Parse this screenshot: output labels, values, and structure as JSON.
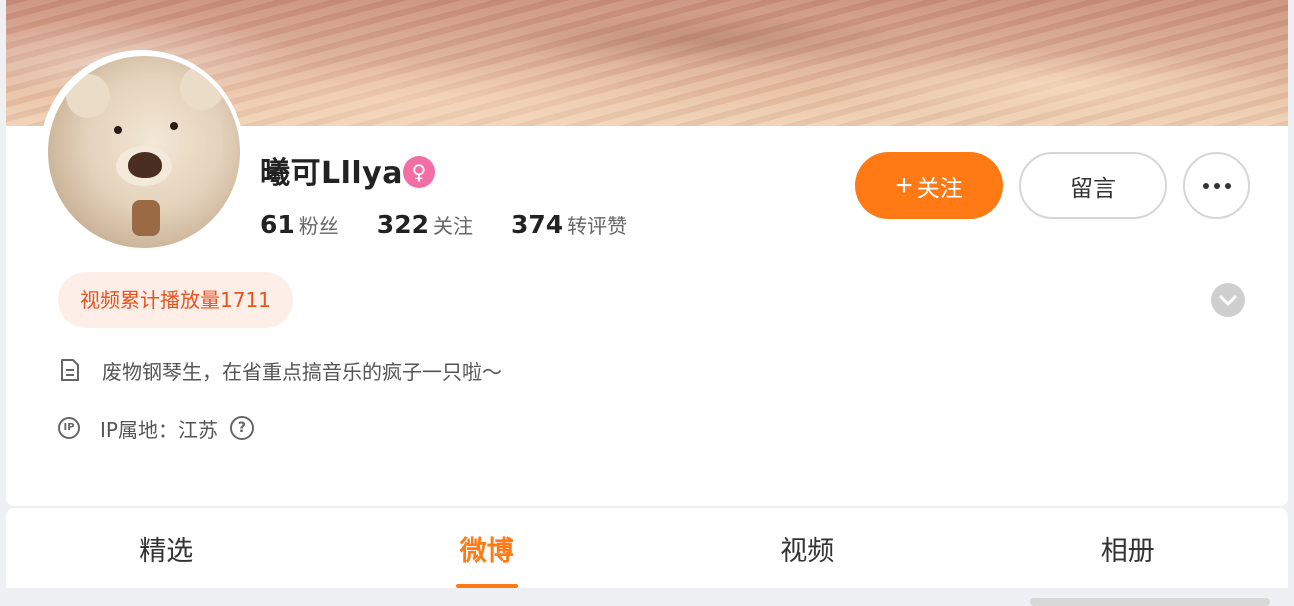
{
  "profile": {
    "name": "曦可Lllya",
    "gender_symbol": "♀",
    "stats": [
      {
        "value": "61",
        "label": "粉丝"
      },
      {
        "value": "322",
        "label": "关注"
      },
      {
        "value": "374",
        "label": "转评赞"
      }
    ],
    "tag": "视频累计播放量1711",
    "bio": "废物钢琴生，在省重点搞音乐的疯子一只啦～",
    "ip_label": "IP属地：江苏",
    "ip_icon_text": "IP",
    "help_icon_text": "?"
  },
  "actions": {
    "follow_plus": "+",
    "follow_label": "关注",
    "message_label": "留言"
  },
  "tabs": [
    {
      "label": "精选"
    },
    {
      "label": "微博"
    },
    {
      "label": "视频"
    },
    {
      "label": "相册"
    }
  ],
  "active_tab": "微博",
  "colors": {
    "accent": "#ff7a14",
    "tag_text": "#e8531e",
    "tag_bg": "#fdeee8",
    "gender_badge": "#f26ea5"
  },
  "icons": {
    "more": "more-icon",
    "expand": "chevron-down-icon",
    "bio": "document-icon",
    "ip": "ip-location-icon",
    "help": "help-icon"
  }
}
